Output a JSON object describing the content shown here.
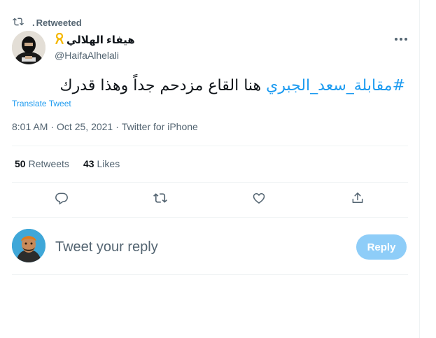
{
  "retweet_banner": {
    "user": ".",
    "label": "Retweeted"
  },
  "author": {
    "display_name": "هيفاء الهلالي",
    "handle": "@HaifaAlhelali"
  },
  "tweet": {
    "hashtag": "#مقابلة_سعد_الجبري",
    "text": " هنا القاع مزدحم جداً وهذا قدرك",
    "translate_label": "Translate Tweet",
    "time": "8:01 AM",
    "date": "Oct 25, 2021",
    "separator": "·",
    "source": "Twitter for iPhone"
  },
  "stats": {
    "retweets_count": "50",
    "retweets_label": "Retweets",
    "likes_count": "43",
    "likes_label": "Likes"
  },
  "reply": {
    "placeholder": "Tweet your reply",
    "button_label": "Reply"
  },
  "icons": {
    "retweet_banner": "retweet-icon",
    "ribbon": "ribbon-icon",
    "more": "more-icon",
    "reply": "reply-icon",
    "retweet": "retweet-icon",
    "like": "heart-icon",
    "share": "share-icon"
  },
  "colors": {
    "accent": "#1d9bf0",
    "reply_button_disabled": "#8ecdf8",
    "secondary_text": "#536471"
  }
}
